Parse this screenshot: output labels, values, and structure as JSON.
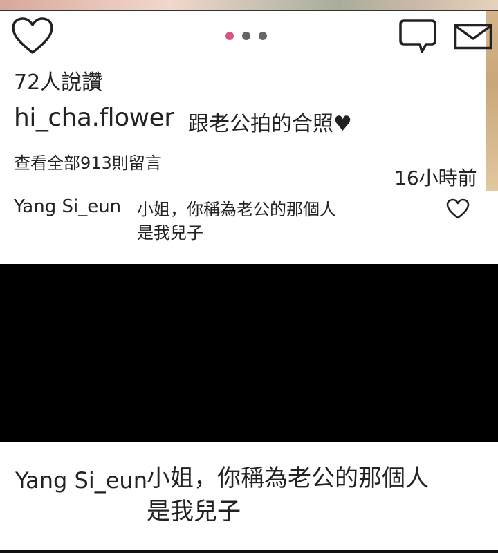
{
  "post": {
    "likes": "72人說讚",
    "username": "hi_cha.flower",
    "caption": "跟老公拍的合照♥",
    "view_all_comments": "查看全部913則留言",
    "time": "16小時前"
  },
  "carousel": {
    "count": 3,
    "active_index": 0,
    "active_color": "#d8557e",
    "inactive_color": "#666666"
  },
  "icons": [
    "heart-icon",
    "comment-icon",
    "mail-icon"
  ],
  "comment": {
    "user": "Yang Si_eun",
    "text": "小姐，你稱為老公的那個人\n是我兒子"
  },
  "subtitle": {
    "user": "Yang Si_eun",
    "text": "小姐，你稱為老公的那個人\n是我兒子"
  }
}
